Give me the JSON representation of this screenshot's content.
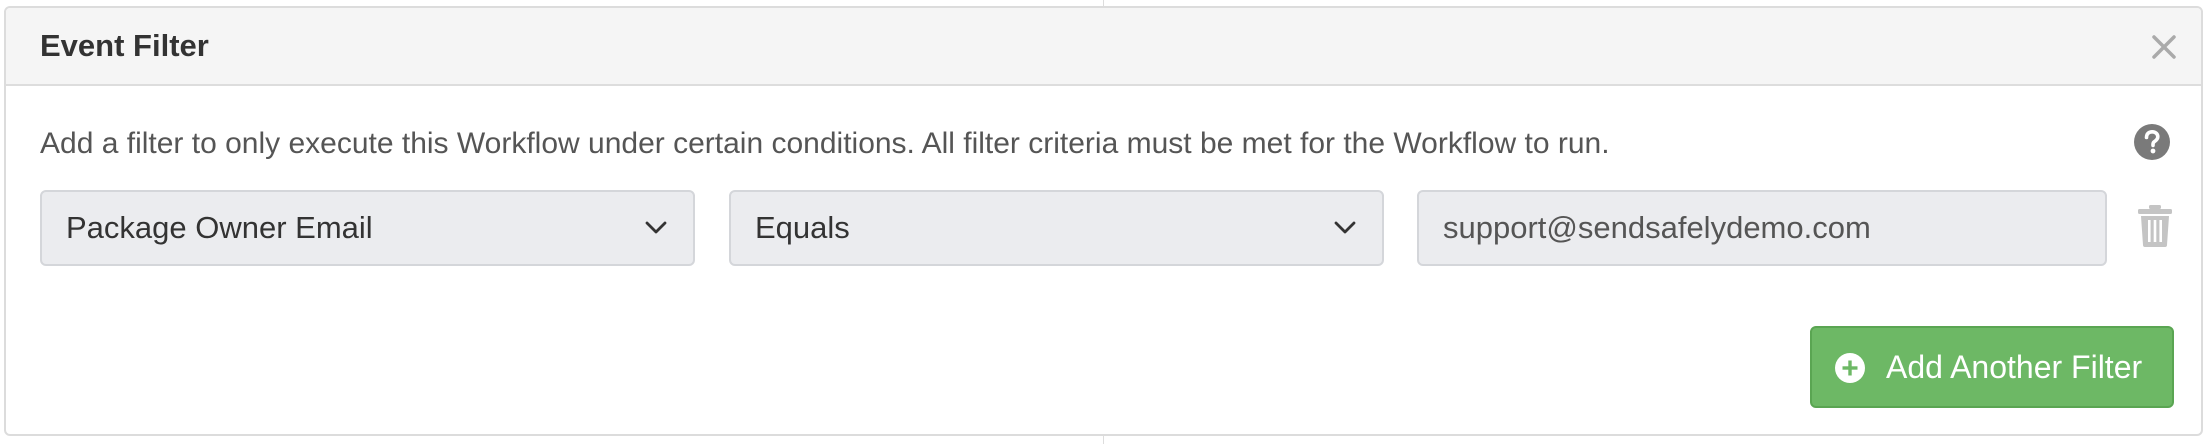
{
  "dialog": {
    "title": "Event Filter",
    "description": "Add a filter to only execute this Workflow under certain conditions. All filter criteria must be met for the Workflow to run."
  },
  "filter_row": {
    "field_select": "Package Owner Email",
    "operator_select": "Equals",
    "value_input": "support@sendsafelydemo.com"
  },
  "actions": {
    "add_filter_label": "Add Another Filter"
  },
  "icons": {
    "close": "close-icon",
    "help": "question-circle-icon",
    "dropdown": "chevron-down-icon",
    "delete": "trash-icon",
    "add": "plus-circle-icon"
  },
  "colors": {
    "header_bg": "#f5f5f5",
    "field_bg": "#ebecef",
    "button_green": "#6db865",
    "icon_gray": "#999999"
  }
}
